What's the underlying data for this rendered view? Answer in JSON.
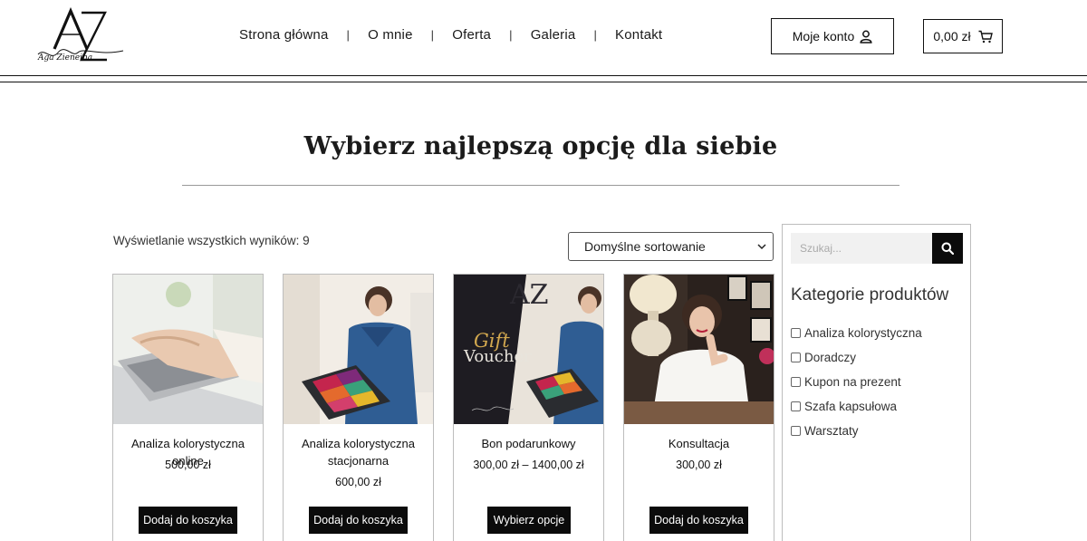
{
  "header": {
    "logo_text": "AZ",
    "logo_signature": "Aga Zieneina",
    "nav": [
      "Strona główna",
      "O mnie",
      "Oferta",
      "Galeria",
      "Kontakt"
    ],
    "nav_separator": "|",
    "account_label": "Moje konto",
    "cart_label": "0,00 zł"
  },
  "main": {
    "title": "Wybierz najlepszą opcję dla siebie",
    "result_count": "Wyświetlanie wszystkich wyników: 9",
    "sort_selected": "Domyślne sortowanie"
  },
  "products": [
    {
      "name": "Analiza kolorystyczna online",
      "price": "500,00 zł",
      "button": "Dodaj do koszyka"
    },
    {
      "name": "Analiza kolorystyczna stacjonarna",
      "price": "600,00 zł",
      "button": "Dodaj do koszyka"
    },
    {
      "name": "Bon podarunkowy",
      "price": "300,00 zł – 1400,00 zł",
      "button": "Wybierz opcje",
      "image_text_1": "Gift",
      "image_text_2": "Voucher"
    },
    {
      "name": "Konsultacja",
      "price": "300,00 zł",
      "button": "Dodaj do koszyka"
    }
  ],
  "sidebar": {
    "search_placeholder": "Szukaj...",
    "categories_title": "Kategorie produktów",
    "categories": [
      "Analiza kolorystyczna",
      "Doradczy",
      "Kupon na prezent",
      "Szafa kapsułowa",
      "Warsztaty"
    ]
  },
  "icons": [
    "user-icon",
    "cart-icon",
    "chevron-down-icon",
    "search-icon"
  ],
  "colors": {
    "accent": "#0b0b0b",
    "text": "#222222",
    "border": "#bdbdbd",
    "voucher_gold": "#d2a84f"
  }
}
